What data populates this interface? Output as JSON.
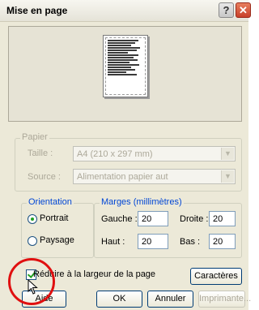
{
  "window": {
    "title": "Mise en page"
  },
  "paper_group": {
    "legend": "Papier",
    "size_label": "Taille :",
    "size_value": "A4 (210 x 297 mm)",
    "source_label": "Source :",
    "source_value": "Alimentation papier aut"
  },
  "orientation": {
    "legend": "Orientation",
    "portrait_label": "Portrait",
    "landscape_label": "Paysage",
    "selected": "Portrait"
  },
  "margins": {
    "legend": "Marges (millimètres)",
    "left_label": "Gauche :",
    "left_value": "20",
    "right_label": "Droite :",
    "right_value": "20",
    "top_label": "Haut :",
    "top_value": "20",
    "bottom_label": "Bas :",
    "bottom_value": "20"
  },
  "shrink_checkbox": {
    "label": "Réduire à la largeur de la page",
    "checked": true
  },
  "buttons": {
    "fonts": "Caractères",
    "help": "Aide",
    "ok": "OK",
    "cancel": "Annuler",
    "printer": "Imprimante..."
  },
  "colors": {
    "group_label": "#0046d5",
    "annotation_circle": "#e01010",
    "check_mark": "#21a121"
  },
  "icons": [
    "help-icon",
    "close-icon",
    "chevron-down-icon",
    "cursor-icon"
  ]
}
